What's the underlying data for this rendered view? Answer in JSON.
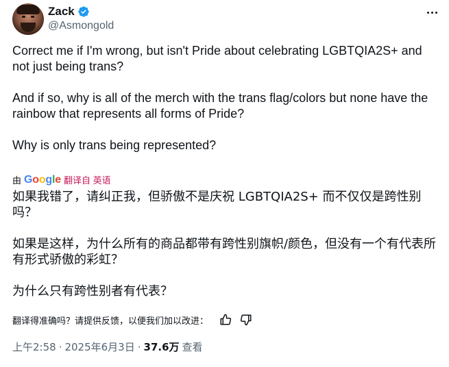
{
  "author": {
    "display_name": "Zack",
    "handle": "@Asmongold",
    "verified": true
  },
  "tweet": {
    "paragraphs": [
      "Correct me if I'm wrong, but isn't Pride about celebrating LGBTQIA2S+ and not just being trans?",
      "And if so, why is all of the merch with the trans flag/colors but none have the rainbow that represents all forms of Pride?",
      "Why is only trans being represented?"
    ]
  },
  "translation": {
    "by_prefix": "由",
    "google": [
      "G",
      "o",
      "o",
      "g",
      "l",
      "e"
    ],
    "link_label": "翻译自 英语",
    "paragraphs": [
      "如果我错了，请纠正我，但骄傲不是庆祝 LGBTQIA2S+ 而不仅仅是跨性别吗？",
      "如果是这样，为什么所有的商品都带有跨性别旗帜/颜色，但没有一个有代表所有形式骄傲的彩虹？",
      "为什么只有跨性别者有代表？"
    ],
    "feedback_prompt": "翻译得准确吗？请提供反馈，以便我们加以改进："
  },
  "meta": {
    "time": "上午2:58",
    "date": "2025年6月3日",
    "separator": "·",
    "views_count": "37.6万",
    "views_label": "查看"
  },
  "colors": {
    "text": "#0f1419",
    "secondary": "#536471",
    "verified_blue": "#1d9bf0",
    "translate_link": "#c51a5a"
  },
  "icons": [
    "more-icon",
    "verified-badge-icon",
    "thumbs-up-icon",
    "thumbs-down-icon"
  ]
}
